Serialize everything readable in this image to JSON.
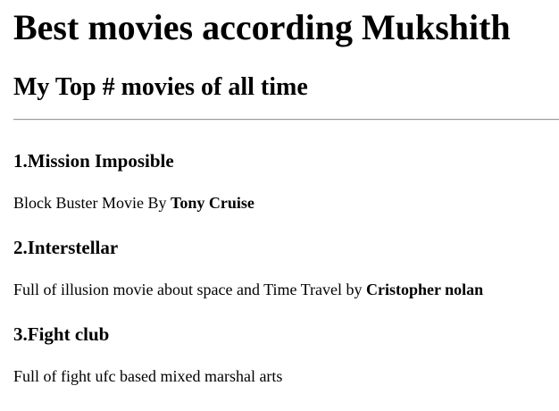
{
  "page": {
    "title": "Best movies according Mukshith",
    "subtitle": "My Top # movies of all time"
  },
  "movies": [
    {
      "title": "1.Mission Imposible",
      "description": "Block Buster Movie By ",
      "highlight": "Tony Cruise"
    },
    {
      "title": "2.Interstellar",
      "description": "Full of illusion movie about space and Time Travel by ",
      "highlight": "Cristopher nolan"
    },
    {
      "title": "3.Fight club",
      "description": "Full of fight ufc based mixed marshal arts",
      "highlight": ""
    }
  ]
}
